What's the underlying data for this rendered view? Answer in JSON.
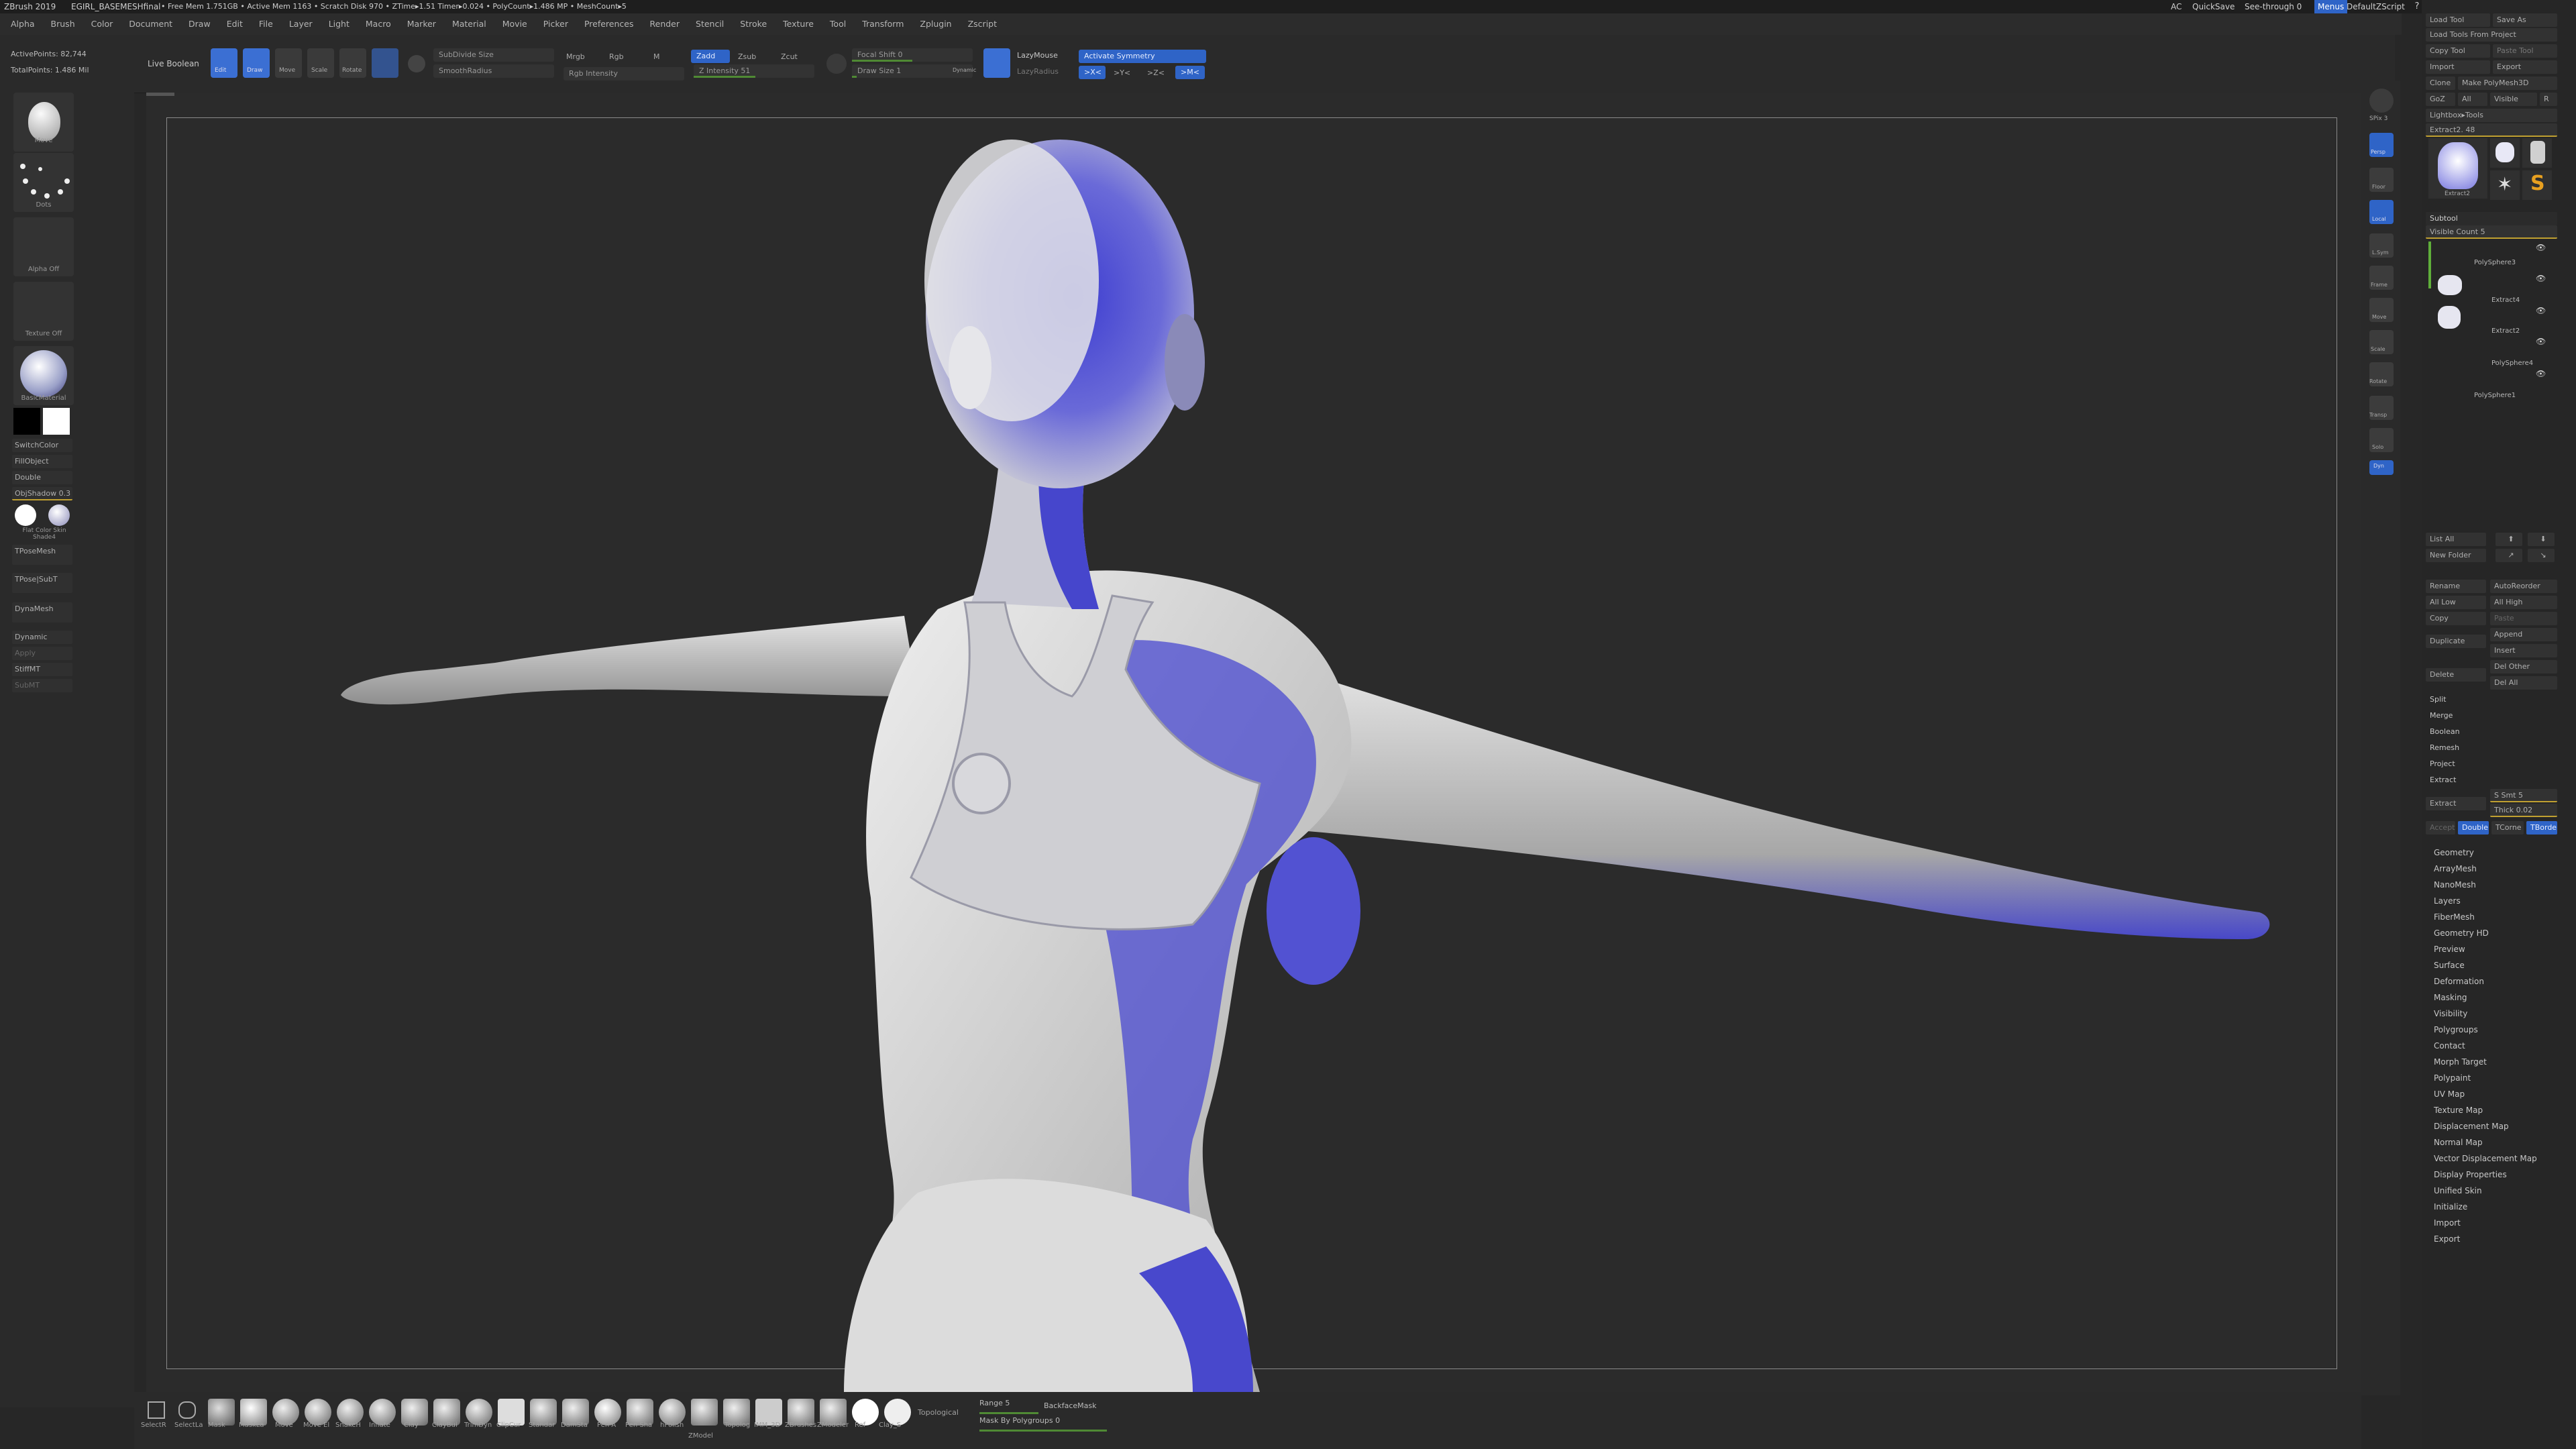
{
  "titlebar": {
    "app": "ZBrush 2019",
    "file": "EGIRL_BASEMESHfinal",
    "stats": "• Free Mem 1.751GB • Active Mem 1163 • Scratch Disk 970 • ZTime▸1.51 Timer▸0.024 • PolyCount▸1.486 MP • MeshCount▸5",
    "ac": "AC",
    "quicksave": "QuickSave",
    "see_through": "See-through  0",
    "menus": "Menus",
    "script": "DefaultZScript"
  },
  "menubar": [
    "Alpha",
    "Brush",
    "Color",
    "Document",
    "Draw",
    "Edit",
    "File",
    "Layer",
    "Light",
    "Macro",
    "Marker",
    "Material",
    "Movie",
    "Picker",
    "Preferences",
    "Render",
    "Stencil",
    "Stroke",
    "Texture",
    "Tool",
    "Transform",
    "Zplugin",
    "Zscript"
  ],
  "stats": {
    "active_points": "ActivePoints: 82,744",
    "total_points": "TotalPoints: 1.486 Mil"
  },
  "topshelf": {
    "live_boolean": "Live Boolean",
    "modes": [
      "Edit",
      "Draw",
      "Move",
      "Scale",
      "Rotate"
    ],
    "subdivide": "SubDivide Size",
    "smooth": "SmoothRadius",
    "mrgb": "Mrgb",
    "rgb": "Rgb",
    "m": "M",
    "rgb_intensity": "Rgb Intensity",
    "zadd": "Zadd",
    "zsub": "Zsub",
    "zcut": "Zcut",
    "z_intensity": "Z Intensity 51",
    "focal_shift": "Focal Shift 0",
    "draw_size": "Draw Size 1",
    "dynamic": "Dynamic",
    "lazymouse": "LazyMouse",
    "lazyradius": "LazyRadius",
    "activate_symmetry": "Activate Symmetry",
    "sym_x": ">X<",
    "sym_y": ">Y<",
    "sym_z": ">Z<",
    "sym_m": ">M<"
  },
  "leftshelf": {
    "brush": "Move",
    "stroke": "Dots",
    "alpha": "Alpha Off",
    "texture": "Texture Off",
    "material": "BasicMaterial",
    "switchcolor": "SwitchColor",
    "fillobject": "FillObject",
    "double": "Double",
    "objshadow": "ObjShadow 0.3",
    "matcaps": "Flat Color  Skin Shade4",
    "tposemesh": "TPoseMesh",
    "tpose_subt": "TPose|SubT",
    "dynamesh": "DynaMesh",
    "dynamic": "Dynamic",
    "apply": "Apply",
    "stiffmt": "StiffMT",
    "subt": "SubMT"
  },
  "rightshelf": [
    "SPix 3",
    "Persp",
    "Floor",
    "Local",
    "L.Sym",
    "Frame",
    "Move",
    "Scale",
    "Rotate",
    "Transp",
    "Solo",
    "Dyn"
  ],
  "palette": {
    "top_buttons": [
      [
        "Load Tool",
        "Save As"
      ],
      [
        "Load Tools From Project",
        ""
      ],
      [
        "Copy Tool",
        "Paste Tool"
      ],
      [
        "Import",
        "Export"
      ],
      [
        "Clone",
        "Make PolyMesh3D"
      ],
      [
        "GoZ",
        "All",
        "Visible",
        "R"
      ]
    ],
    "lightbox_tools": "Lightbox▸Tools",
    "extract_title": "Extract2. 48",
    "tool_thumbs": [
      "Extract2",
      "Extract2",
      "Cylinder3D",
      "PolyMesh3D",
      "SimpleBrush"
    ],
    "subtool": "Subtool",
    "visible_count": "Visible Count 5",
    "subtools": [
      "PolySphere3",
      "Extract4",
      "Extract2",
      "PolySphere4",
      "PolySphere1"
    ],
    "list_all": "List All",
    "new_folder": "New Folder",
    "rename": "Rename",
    "autoreorder": "AutoReorder",
    "all_low": "All Low",
    "all_high": "All High",
    "copy": "Copy",
    "paste": "Paste",
    "duplicate": "Duplicate",
    "append": "Append",
    "insert": "Insert",
    "delete": "Delete",
    "del_other": "Del Other",
    "del_all": "Del All",
    "split": "Split",
    "merge": "Merge",
    "boolean": "Boolean",
    "remesh": "Remesh",
    "project": "Project",
    "extract": "Extract",
    "s_smt": "S Smt 5",
    "thick": "Thick 0.02",
    "accept": "Accept",
    "double_btn": "Double",
    "tcorne": "TCorne",
    "tborder": "TBorder",
    "menus": [
      "Geometry",
      "ArrayMesh",
      "NanoMesh",
      "Layers",
      "FiberMesh",
      "Geometry HD",
      "Preview",
      "Surface",
      "Deformation",
      "Masking",
      "Visibility",
      "Polygroups",
      "Contact",
      "Morph Target",
      "Polypaint",
      "UV Map",
      "Texture Map",
      "Displacement Map",
      "Normal Map",
      "Vector Displacement Map",
      "Display Properties",
      "Unified Skin",
      "Initialize",
      "Import",
      "Export"
    ]
  },
  "bottomshelf": {
    "brushes": [
      "SelectR",
      "SelectLa",
      "Mask",
      "MaskLa",
      "Move",
      "Move El",
      "SnakeH",
      "Inflate",
      "Clay",
      "ClayBui",
      "TrimDyn",
      "ClipCur",
      "Standar",
      "DamSta",
      "Pen A",
      "Pen Sha",
      "hPolish",
      "ZModel",
      "Topolog",
      "IMM_3D",
      "ZBrushes",
      "ZModeler",
      "Ref",
      "Clay_S",
      "Topological"
    ],
    "range": "Range 5",
    "backface": "BackfaceMask",
    "mask_by_polygroups": "Mask By Polygroups 0"
  },
  "colors": {
    "accent": "#2f64c7",
    "canvas": "#2b2b2b",
    "body_grey": "#d4d4d4",
    "body_shadow": "#3a3ac8"
  }
}
